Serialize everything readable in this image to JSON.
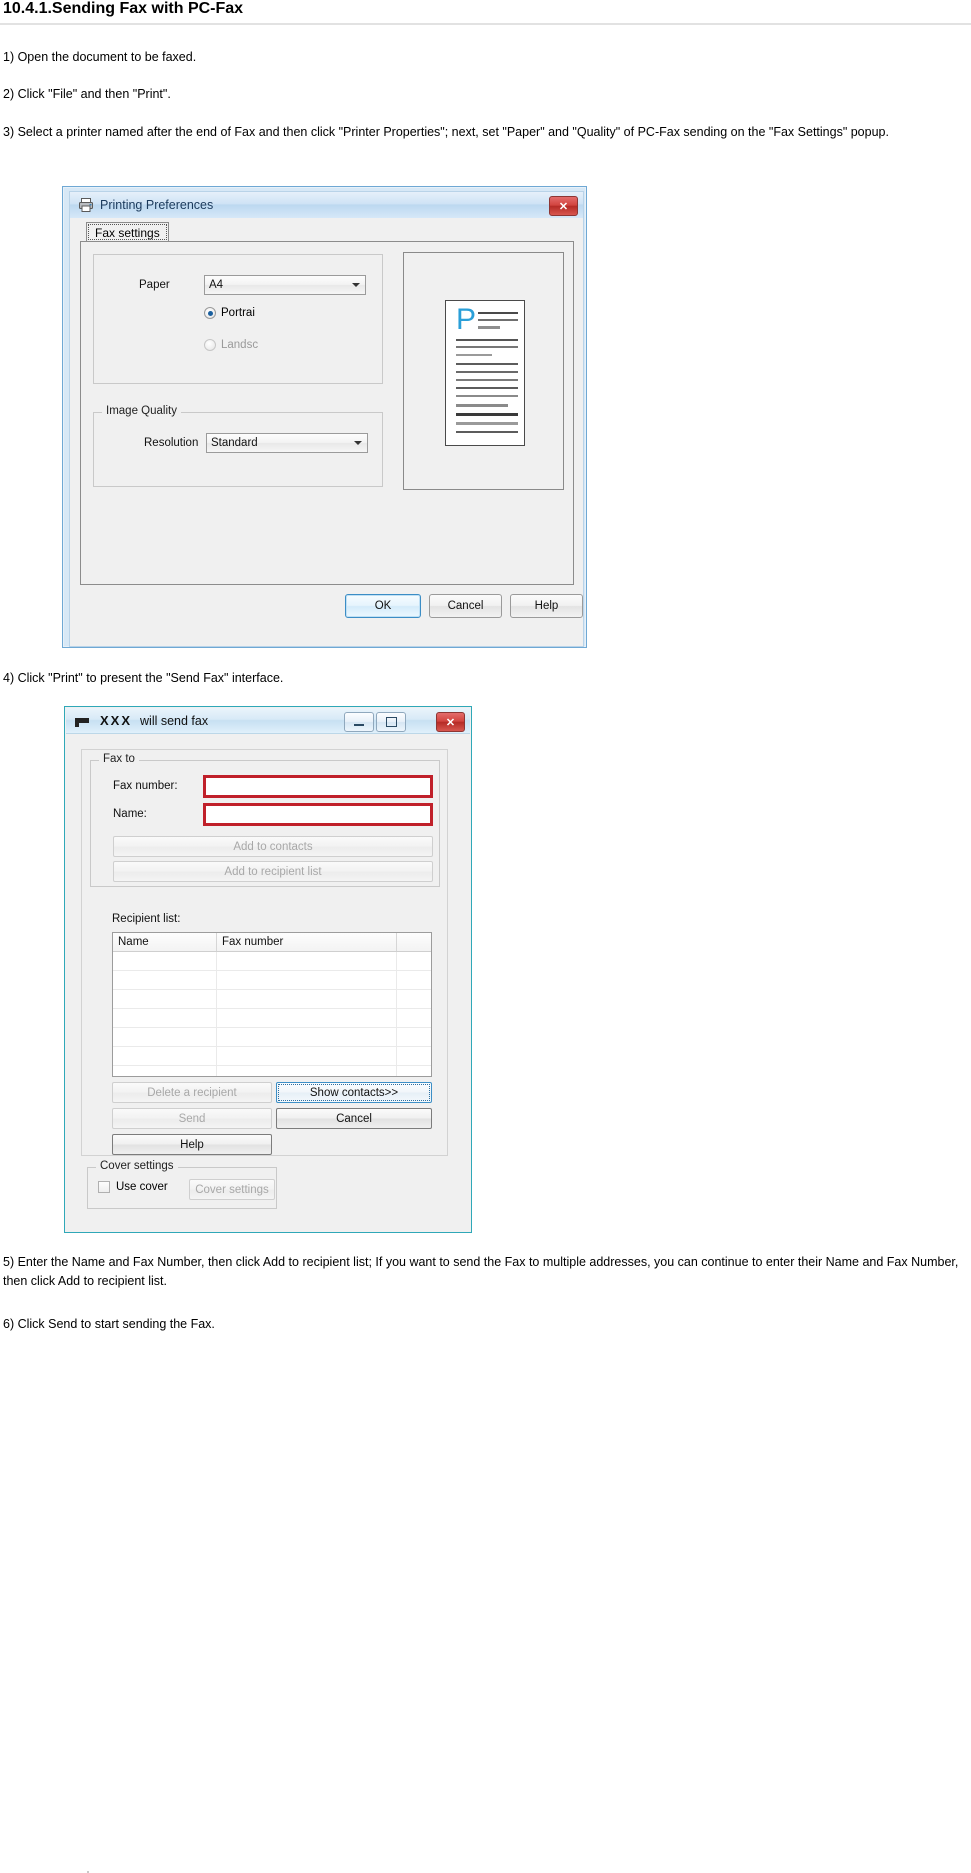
{
  "document": {
    "heading": "10.4.1.Sending Fax with PC-Fax",
    "steps": {
      "s1": "1) Open the document to be faxed.",
      "s2": "2) Click \"File\" and then \"Print\".",
      "s3": "3) Select a printer named after the end of Fax and then click \"Printer Properties\"; next, set \"Paper\" and \"Quality\" of PC-Fax sending on the \"Fax Settings\" popup.",
      "s4": "4) Click \"Print\" to present the \"Send Fax\" interface.",
      "s5": "5) Enter the Name and Fax Number, then click Add to recipient list; If you want to send the Fax to multiple addresses, you can continue to enter their Name and Fax Number, then click Add to recipient list.",
      "s6": "6) Click Send to start sending the Fax."
    }
  },
  "printing_preferences": {
    "title": "Printing Preferences",
    "icon": "printer-icon",
    "close_label": "✕",
    "tab": {
      "label": "Fax settings"
    },
    "paper": {
      "label": "Paper",
      "size_value": "A4",
      "orientation": [
        {
          "label": "Portrai",
          "selected": true,
          "enabled": true
        },
        {
          "label": "Landsc",
          "selected": false,
          "enabled": false
        }
      ]
    },
    "image_quality": {
      "group_label": "Image Quality",
      "resolution_label": "Resolution",
      "resolution_value": "Standard"
    },
    "preview": {
      "letter": "P"
    },
    "buttons": {
      "ok": "OK",
      "cancel": "Cancel",
      "help": "Help"
    }
  },
  "send_fax": {
    "title_prefix": "XXX",
    "title_suffix": "will send fax",
    "icon": "fax-icon",
    "window_buttons": {
      "minimize": "minimize-icon",
      "maximize": "maximize-icon",
      "close": "✕"
    },
    "fax_to": {
      "group_label": "Fax to",
      "fax_number_label": "Fax number:",
      "fax_number_value": "",
      "name_label": "Name:",
      "name_value": "",
      "add_to_contacts": "Add to contacts",
      "add_to_recipient_list": "Add to recipient list"
    },
    "recipient_list": {
      "label": "Recipient list:",
      "columns": [
        "Name",
        "Fax number",
        ""
      ],
      "rows": [],
      "empty_row_count": 7
    },
    "actions": {
      "delete_recipient": "Delete a recipient",
      "show_contacts": "Show contacts>>",
      "send": "Send",
      "cancel": "Cancel",
      "help": "Help"
    },
    "cover": {
      "group_label": "Cover settings",
      "use_cover_label": "Use cover",
      "use_cover_checked": false,
      "cover_settings_button": "Cover settings"
    }
  },
  "colors": {
    "accent_blue": "#2a9fd8",
    "close_red": "#c0202a",
    "field_highlight": "#c0202a",
    "window_border_teal": "#2fa8b8",
    "window_border_blue": "#6fa8d4"
  }
}
